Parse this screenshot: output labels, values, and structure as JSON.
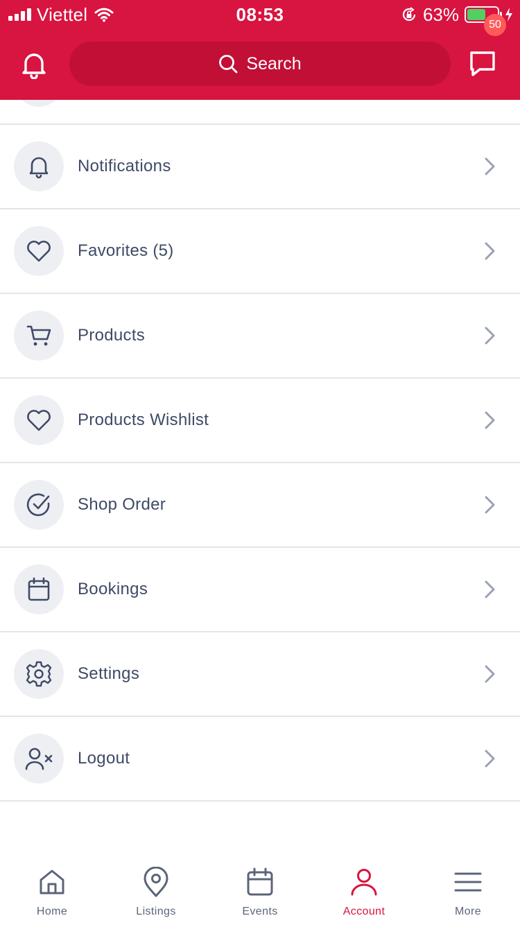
{
  "status_bar": {
    "carrier": "Viettel",
    "time": "08:53",
    "battery_percent": "63%",
    "battery_level": 0.63
  },
  "header": {
    "search_placeholder": "Search",
    "message_badge": "50",
    "brand_color": "#d81440"
  },
  "menu": {
    "items": [
      {
        "label": "Notifications",
        "icon": "bell-icon"
      },
      {
        "label": "Favorites (5)",
        "icon": "heart-icon"
      },
      {
        "label": "Products",
        "icon": "cart-icon"
      },
      {
        "label": "Products Wishlist",
        "icon": "heart-icon"
      },
      {
        "label": "Shop Order",
        "icon": "check-circle-icon"
      },
      {
        "label": "Bookings",
        "icon": "calendar-icon"
      },
      {
        "label": "Settings",
        "icon": "gear-icon"
      },
      {
        "label": "Logout",
        "icon": "user-x-icon"
      }
    ]
  },
  "tabbar": {
    "tabs": [
      {
        "label": "Home",
        "icon": "home-icon"
      },
      {
        "label": "Listings",
        "icon": "map-pin-icon"
      },
      {
        "label": "Events",
        "icon": "calendar-icon"
      },
      {
        "label": "Account",
        "icon": "user-icon",
        "active": true
      },
      {
        "label": "More",
        "icon": "menu-icon"
      }
    ],
    "active_color": "#d81440"
  }
}
